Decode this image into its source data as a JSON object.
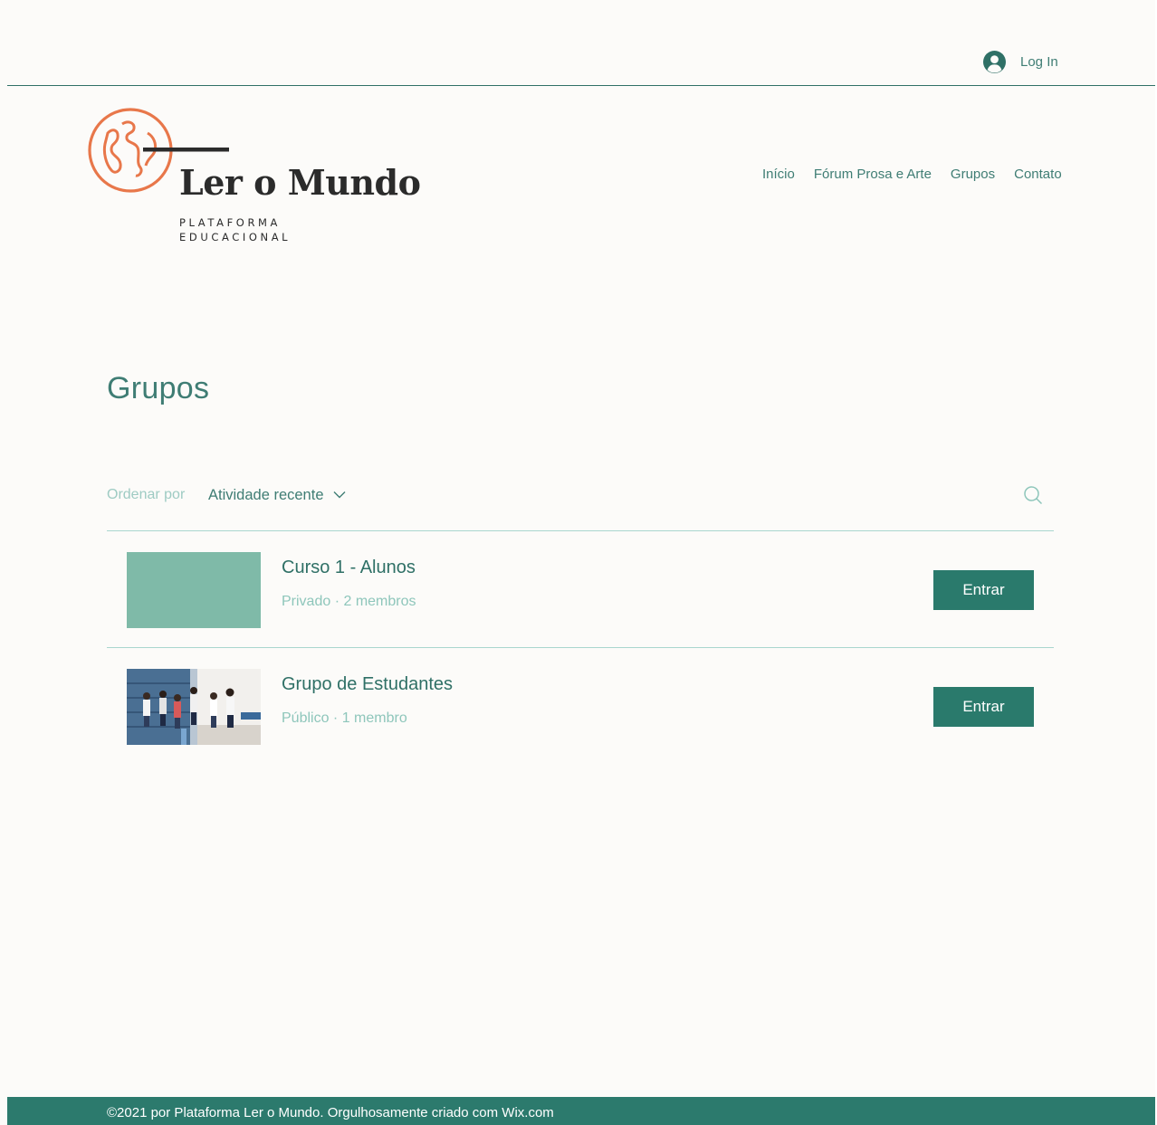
{
  "header": {
    "login_label": "Log In",
    "nav": [
      "Início",
      "Fórum Prosa e Arte",
      "Grupos",
      "Contato"
    ]
  },
  "logo": {
    "title": "Ler o Mundo",
    "subtitle_line1": "PLATAFORMA",
    "subtitle_line2": "EDUCACIONAL"
  },
  "main": {
    "title": "Grupos",
    "sort": {
      "label": "Ordenar por",
      "value": "Atividade recente"
    },
    "groups": [
      {
        "name": "Curso 1 - Alunos",
        "meta": "Privado · 2 membros",
        "button": "Entrar",
        "thumbnail": "solid-color"
      },
      {
        "name": "Grupo de Estudantes",
        "meta": "Público · 1 membro",
        "button": "Entrar",
        "thumbnail": "students-photo"
      }
    ]
  },
  "footer": {
    "text": "©2021 por Plataforma Ler o Mundo. Orgulhosamente criado com Wix.com"
  },
  "colors": {
    "accent": "#2a7a6c",
    "text_teal": "#3f7d74",
    "muted_teal": "#8ec6bb",
    "logo_orange": "#e8774a",
    "background": "#fcfbf9"
  }
}
